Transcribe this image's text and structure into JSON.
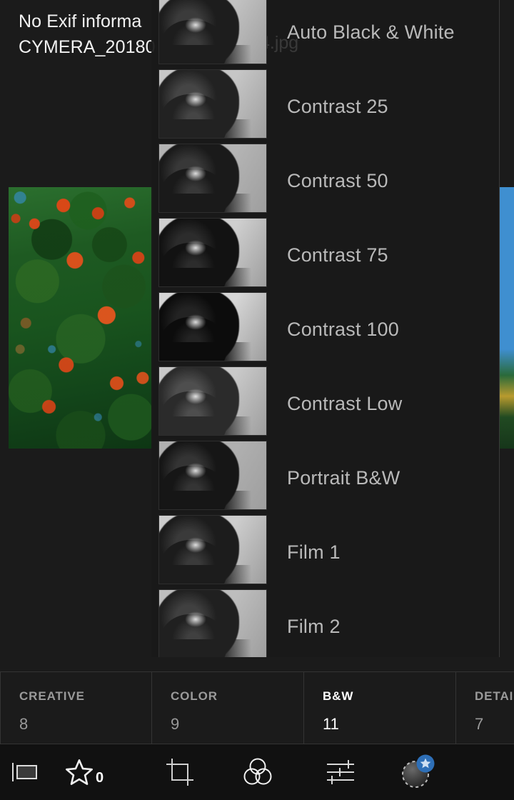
{
  "app": {
    "accent_blue": "#2e6fb7",
    "panel_bg": "#1a1a1a",
    "text_muted": "#9a9a9a",
    "text_bright": "#ffffff"
  },
  "header": {
    "exif_line": "No Exif informa",
    "filename_line": "CYMERA_20180",
    "filename_bleed": "4.jpg"
  },
  "presets_panel": {
    "items": [
      {
        "label": "Auto Black & White",
        "thumb_contrast": "auto"
      },
      {
        "label": "Contrast 25",
        "thumb_contrast": "25"
      },
      {
        "label": "Contrast 50",
        "thumb_contrast": "50"
      },
      {
        "label": "Contrast 75",
        "thumb_contrast": "75"
      },
      {
        "label": "Contrast 100",
        "thumb_contrast": "100"
      },
      {
        "label": "Contrast Low",
        "thumb_contrast": "low"
      },
      {
        "label": "Portrait B&W",
        "thumb_contrast": "portrait"
      },
      {
        "label": "Film 1",
        "thumb_contrast": "film1"
      },
      {
        "label": "Film 2",
        "thumb_contrast": "film2"
      }
    ]
  },
  "category_tabs": [
    {
      "name": "CREATIVE",
      "count": "8",
      "active": false
    },
    {
      "name": "COLOR",
      "count": "9",
      "active": false
    },
    {
      "name": "B&W",
      "count": "11",
      "active": true
    },
    {
      "name": "DETAIL",
      "count": "7",
      "active": false
    }
  ],
  "tool_bar": {
    "flag_icon": "filmstrip-flag-icon",
    "rating_icon": "star-rating-icon",
    "rating_value": "0",
    "crop_icon": "crop-icon",
    "color_mix_icon": "color-mix-circles-icon",
    "light_icon": "sliders-icon",
    "presets_icon": "presets-star-badge-icon"
  }
}
